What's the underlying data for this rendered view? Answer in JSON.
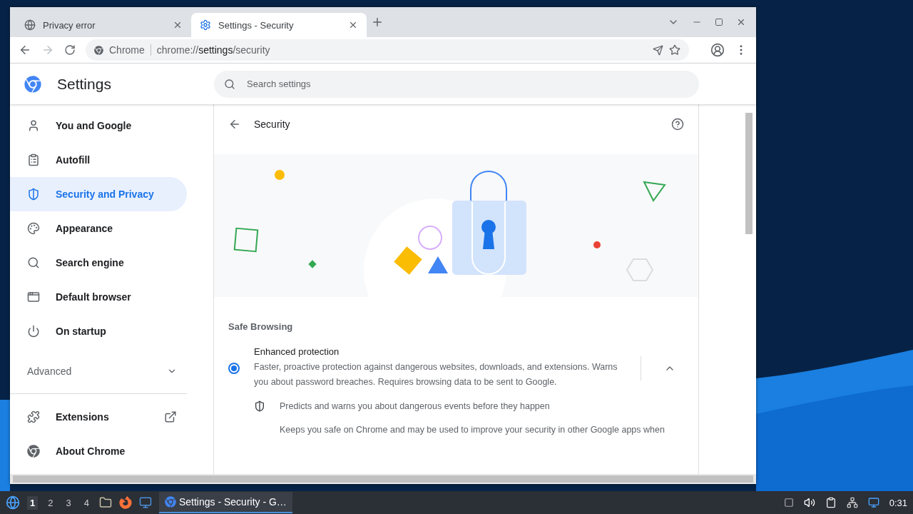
{
  "tabs": [
    {
      "title": "Privacy error",
      "kind": "globe",
      "selected": false
    },
    {
      "title": "Settings - Security",
      "kind": "gear",
      "selected": true
    }
  ],
  "address_bar": {
    "site_label": "Chrome",
    "url": {
      "scheme": "chrome://",
      "host": "settings",
      "path": "/security"
    }
  },
  "settings_header": {
    "title": "Settings",
    "search": {
      "placeholder": "Search settings"
    }
  },
  "sidebar": {
    "items": [
      {
        "label": "You and Google",
        "kind": "person",
        "selected": false
      },
      {
        "label": "Autofill",
        "kind": "clipboard",
        "selected": false
      },
      {
        "label": "Security and Privacy",
        "kind": "shield",
        "selected": true
      },
      {
        "label": "Appearance",
        "kind": "palette",
        "selected": false
      },
      {
        "label": "Search engine",
        "kind": "search",
        "selected": false
      },
      {
        "label": "Default browser",
        "kind": "browser",
        "selected": false
      },
      {
        "label": "On startup",
        "kind": "power",
        "selected": false
      }
    ],
    "advanced": {
      "label": "Advanced",
      "expanded": false
    },
    "links": [
      {
        "label": "Extensions",
        "kind": "puzzle",
        "external": true
      },
      {
        "label": "About Chrome",
        "kind": "chrome",
        "external": false
      }
    ]
  },
  "page": {
    "title": "Security",
    "section": "Safe Browsing",
    "option": {
      "title": "Enhanced protection",
      "description": "Faster, proactive protection against dangerous websites, downloads, and extensions. Warns you about password breaches. Requires browsing data to be sent to Google.",
      "selected": true,
      "expanded": true
    },
    "details": [
      {
        "text": "Predicts and warns you about dangerous events before they happen",
        "kind": "shield"
      },
      {
        "text": "Keeps you safe on Chrome and may be used to improve your security in other Google apps when",
        "kind": "plain"
      }
    ]
  },
  "taskbar": {
    "workspaces": [
      {
        "label": "1",
        "selected": true
      },
      {
        "label": "2",
        "selected": false
      },
      {
        "label": "3",
        "selected": false
      },
      {
        "label": "4",
        "selected": false
      }
    ],
    "task": {
      "label": "Settings - Security - G…",
      "selected": true
    },
    "clock": "0:31"
  }
}
